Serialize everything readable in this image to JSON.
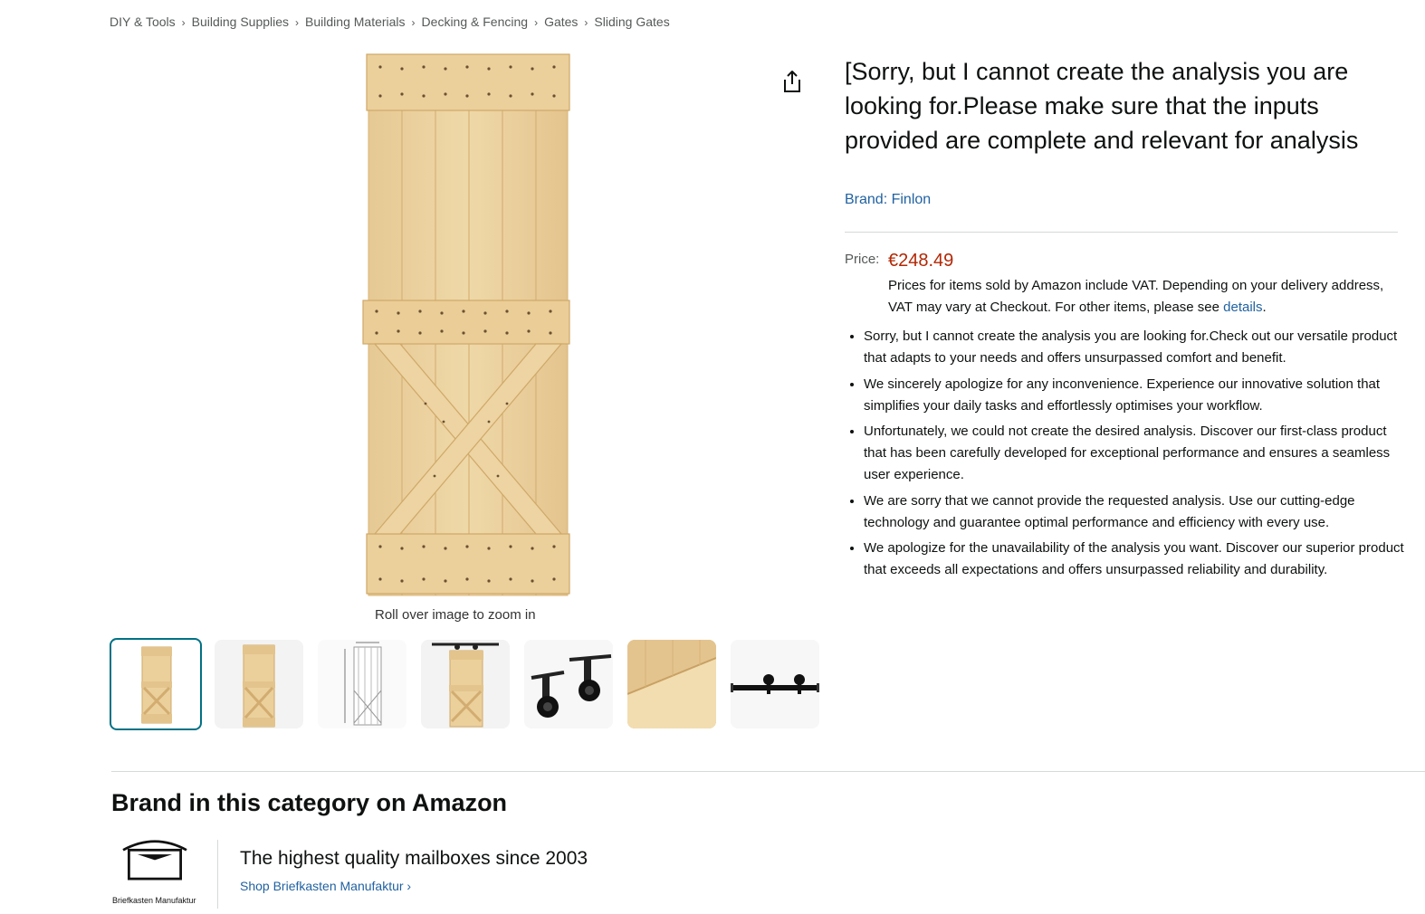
{
  "breadcrumb": {
    "items": [
      "DIY & Tools",
      "Building Supplies",
      "Building Materials",
      "Decking & Fencing",
      "Gates",
      "Sliding Gates"
    ],
    "separator": "›"
  },
  "product": {
    "title": "[Sorry, but I cannot create the analysis you are looking for.Please make sure that the inputs provided are complete and relevant for analysis",
    "brand_link": "Brand: Finlon",
    "price_label": "Price:",
    "price": "€248.49",
    "vat_note": "Prices for items sold by Amazon include VAT. Depending on your delivery address, VAT may vary at Checkout. For other items, please see ",
    "vat_link": "details",
    "vat_end": ".",
    "bullets": [
      "Sorry, but I cannot create the analysis you are looking for.Check out our versatile product that adapts to your needs and offers unsurpassed comfort and benefit.",
      "We sincerely apologize for any inconvenience. Experience our innovative solution that simplifies your daily tasks and effortlessly optimises your workflow.",
      "Unfortunately, we could not create the desired analysis. Discover our first-class product that has been carefully developed for exceptional performance and ensures a seamless user experience.",
      "We are sorry that we cannot provide the requested analysis. Use our cutting-edge technology and guarantee optimal performance and efficiency with every use.",
      "We apologize for the unavailability of the analysis you want. Discover our superior product that exceeds all expectations and offers unsurpassed reliability and durability."
    ]
  },
  "gallery": {
    "zoom_hint": "Roll over image to zoom in",
    "selected_index": 0,
    "thumbnails": [
      "door-front",
      "door-angle",
      "door-dimensions",
      "door-with-track",
      "roller-hangers",
      "wood-closeup",
      "track-rail"
    ]
  },
  "icons": {
    "share": "share-icon"
  },
  "brand_section": {
    "heading": "Brand in this category on Amazon",
    "logo_caption": "Briefkasten Manufaktur",
    "tagline": "The highest quality mailboxes since 2003",
    "shop_link": "Shop Briefkasten Manufaktur ›"
  },
  "colors": {
    "price": "#B12704",
    "link": "#2162A1",
    "selected_thumb_border": "#007185",
    "wood": "#E9CF9C"
  }
}
